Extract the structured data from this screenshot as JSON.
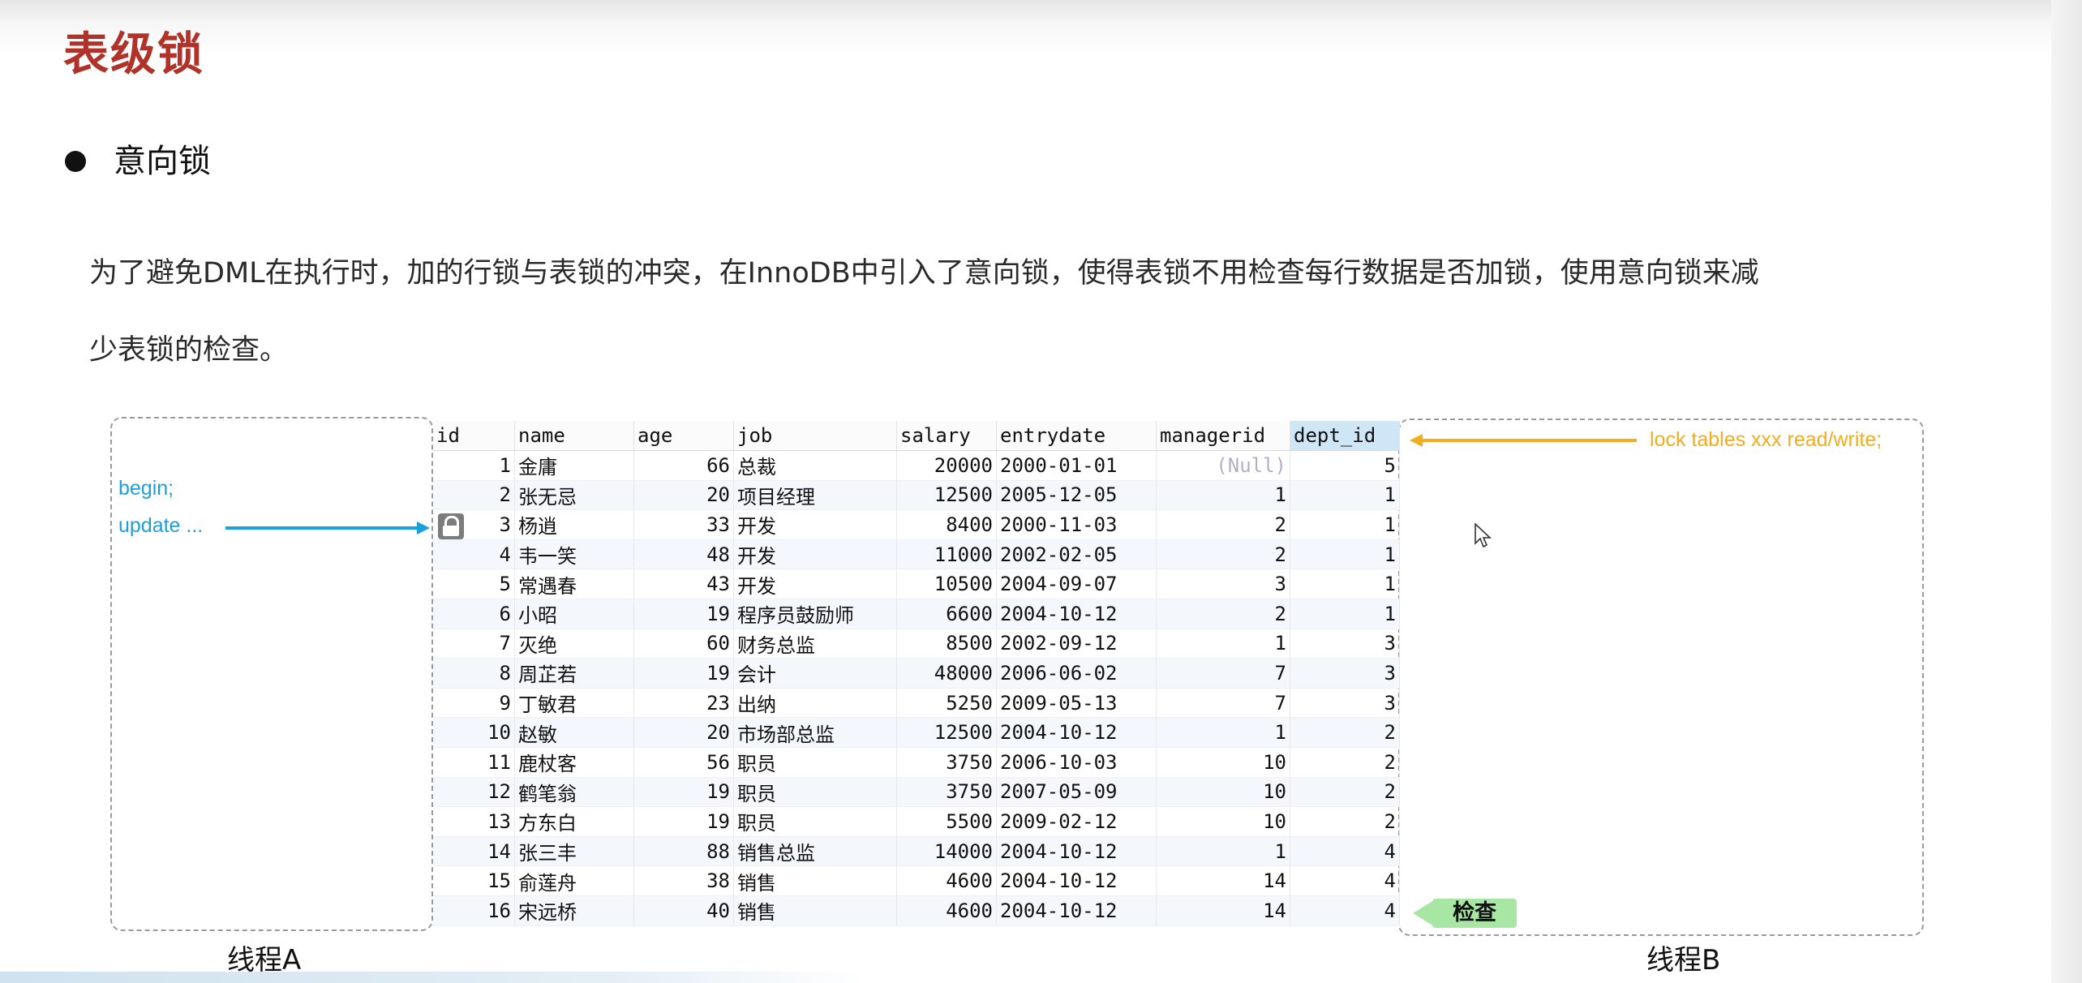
{
  "slide": {
    "title": "表级锁",
    "bullet": "意向锁",
    "description_line1": "为了避免DML在执行时，加的行锁与表锁的冲突，在InnoDB中引入了意向锁，使得表锁不用检查每行数据是否加锁，使用意向锁来减",
    "description_line2": "少表锁的检查。"
  },
  "threadA": {
    "line1": "begin;",
    "line2": "update ...",
    "caption": "线程A"
  },
  "threadB": {
    "command": "lock tables xxx read/write;",
    "check_label": "检查",
    "caption": "线程B"
  },
  "table": {
    "columns": [
      "id",
      "name",
      "age",
      "job",
      "salary",
      "entrydate",
      "managerid",
      "dept_id"
    ],
    "rows": [
      [
        "1",
        "金庸",
        "66",
        "总裁",
        "20000",
        "2000-01-01",
        "(Null)",
        "5"
      ],
      [
        "2",
        "张无忌",
        "20",
        "项目经理",
        "12500",
        "2005-12-05",
        "1",
        "1"
      ],
      [
        "3",
        "杨逍",
        "33",
        "开发",
        "8400",
        "2000-11-03",
        "2",
        "1"
      ],
      [
        "4",
        "韦一笑",
        "48",
        "开发",
        "11000",
        "2002-02-05",
        "2",
        "1"
      ],
      [
        "5",
        "常遇春",
        "43",
        "开发",
        "10500",
        "2004-09-07",
        "3",
        "1"
      ],
      [
        "6",
        "小昭",
        "19",
        "程序员鼓励师",
        "6600",
        "2004-10-12",
        "2",
        "1"
      ],
      [
        "7",
        "灭绝",
        "60",
        "财务总监",
        "8500",
        "2002-09-12",
        "1",
        "3"
      ],
      [
        "8",
        "周芷若",
        "19",
        "会计",
        "48000",
        "2006-06-02",
        "7",
        "3"
      ],
      [
        "9",
        "丁敏君",
        "23",
        "出纳",
        "5250",
        "2009-05-13",
        "7",
        "3"
      ],
      [
        "10",
        "赵敏",
        "20",
        "市场部总监",
        "12500",
        "2004-10-12",
        "1",
        "2"
      ],
      [
        "11",
        "鹿杖客",
        "56",
        "职员",
        "3750",
        "2006-10-03",
        "10",
        "2"
      ],
      [
        "12",
        "鹤笔翁",
        "19",
        "职员",
        "3750",
        "2007-05-09",
        "10",
        "2"
      ],
      [
        "13",
        "方东白",
        "19",
        "职员",
        "5500",
        "2009-02-12",
        "10",
        "2"
      ],
      [
        "14",
        "张三丰",
        "88",
        "销售总监",
        "14000",
        "2004-10-12",
        "1",
        "4"
      ],
      [
        "15",
        "俞莲舟",
        "38",
        "销售",
        "4600",
        "2004-10-12",
        "14",
        "4"
      ],
      [
        "16",
        "宋远桥",
        "40",
        "销售",
        "4600",
        "2004-10-12",
        "14",
        "4"
      ]
    ]
  },
  "colors": {
    "title": "#b03228",
    "threadA_text": "#1aa0dc",
    "threadB_text": "#f3ac1c",
    "check_badge": "#a8e6a4"
  },
  "icons": {
    "lock": "lock-icon",
    "cursor": "mouse-pointer-icon"
  }
}
